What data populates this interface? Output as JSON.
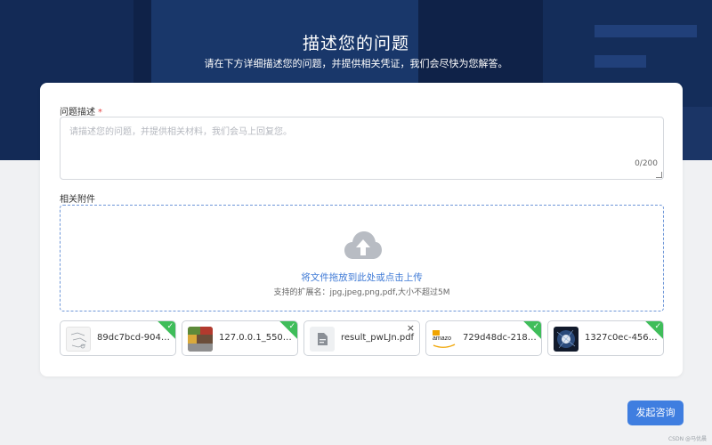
{
  "header": {
    "title": "描述您的问题",
    "subtitle": "请在下方详细描述您的问题，并提供相关凭证，我们会尽快为您解答。"
  },
  "form": {
    "description": {
      "label": "问题描述",
      "required_mark": "*",
      "placeholder": "请描述您的问题，并提供相关材料，我们会马上回复您。",
      "value": "",
      "counter": "0/200"
    },
    "attachments": {
      "label": "相关附件",
      "upload_icon": "cloud-upload-icon",
      "drop_text": "将文件拖放到此处或点击上传",
      "hint": "支持的扩展名：jpg,jpeg,png,pdf,大小不超过5M"
    },
    "files": [
      {
        "name": "89dc7bcd-9048...",
        "thumb": "sketch",
        "status": "uploaded"
      },
      {
        "name": "127.0.0.1_5500...",
        "thumb": "blocks",
        "status": "uploaded"
      },
      {
        "name": "result_pwLJn.pdf",
        "thumb": "document",
        "status": "removable"
      },
      {
        "name": "729d48dc-218c...",
        "thumb": "amazon",
        "thumb_text": "amazo",
        "status": "uploaded"
      },
      {
        "name": "1327c0ec-456a...",
        "thumb": "dark",
        "status": "uploaded"
      }
    ]
  },
  "actions": {
    "submit_label": "发起咨询"
  },
  "watermark": "CSDN @马优晨",
  "colors": {
    "header_bg": "#0f2248",
    "accent": "#3f7ee0",
    "success": "#3fbd5a",
    "required": "#e54545"
  }
}
